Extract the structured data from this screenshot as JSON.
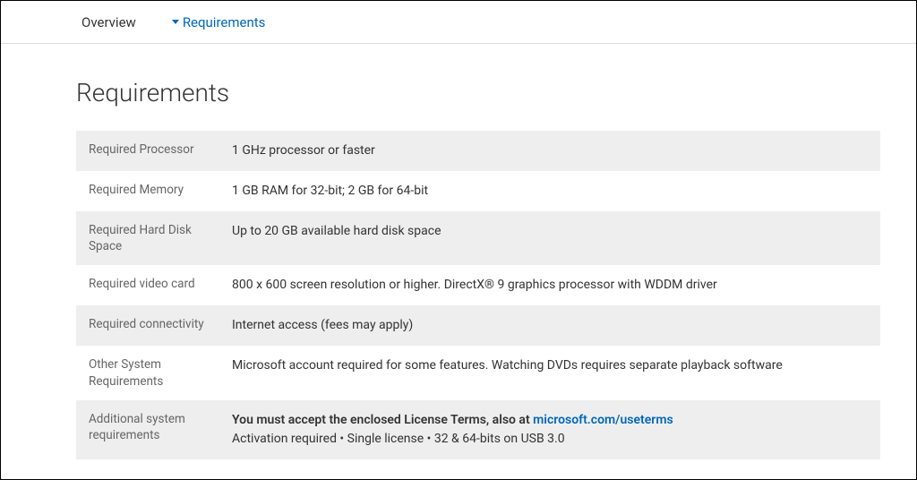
{
  "tabs": {
    "overview": "Overview",
    "requirements": "Requirements"
  },
  "title": "Requirements",
  "rows": [
    {
      "label": "Required Processor",
      "value": "1 GHz processor or faster"
    },
    {
      "label": "Required Memory",
      "value": "1 GB RAM for 32-bit; 2 GB for 64-bit"
    },
    {
      "label": "Required Hard Disk Space",
      "value": "Up to 20 GB available hard disk space"
    },
    {
      "label": "Required video card",
      "value": "800 x 600 screen resolution or higher. DirectX® 9 graphics processor with WDDM driver"
    },
    {
      "label": "Required connectivity",
      "value": "Internet access (fees may apply)"
    },
    {
      "label": "Other System Requirements",
      "value": "Microsoft account required for some features. Watching DVDs requires separate playback software"
    }
  ],
  "additional": {
    "label": "Additional system requirements",
    "bold_prefix": "You must accept the enclosed License Terms, also at ",
    "link_text": "microsoft.com/useterms",
    "line2": "Activation required • Single license • 32 & 64-bits on USB 3.0"
  }
}
